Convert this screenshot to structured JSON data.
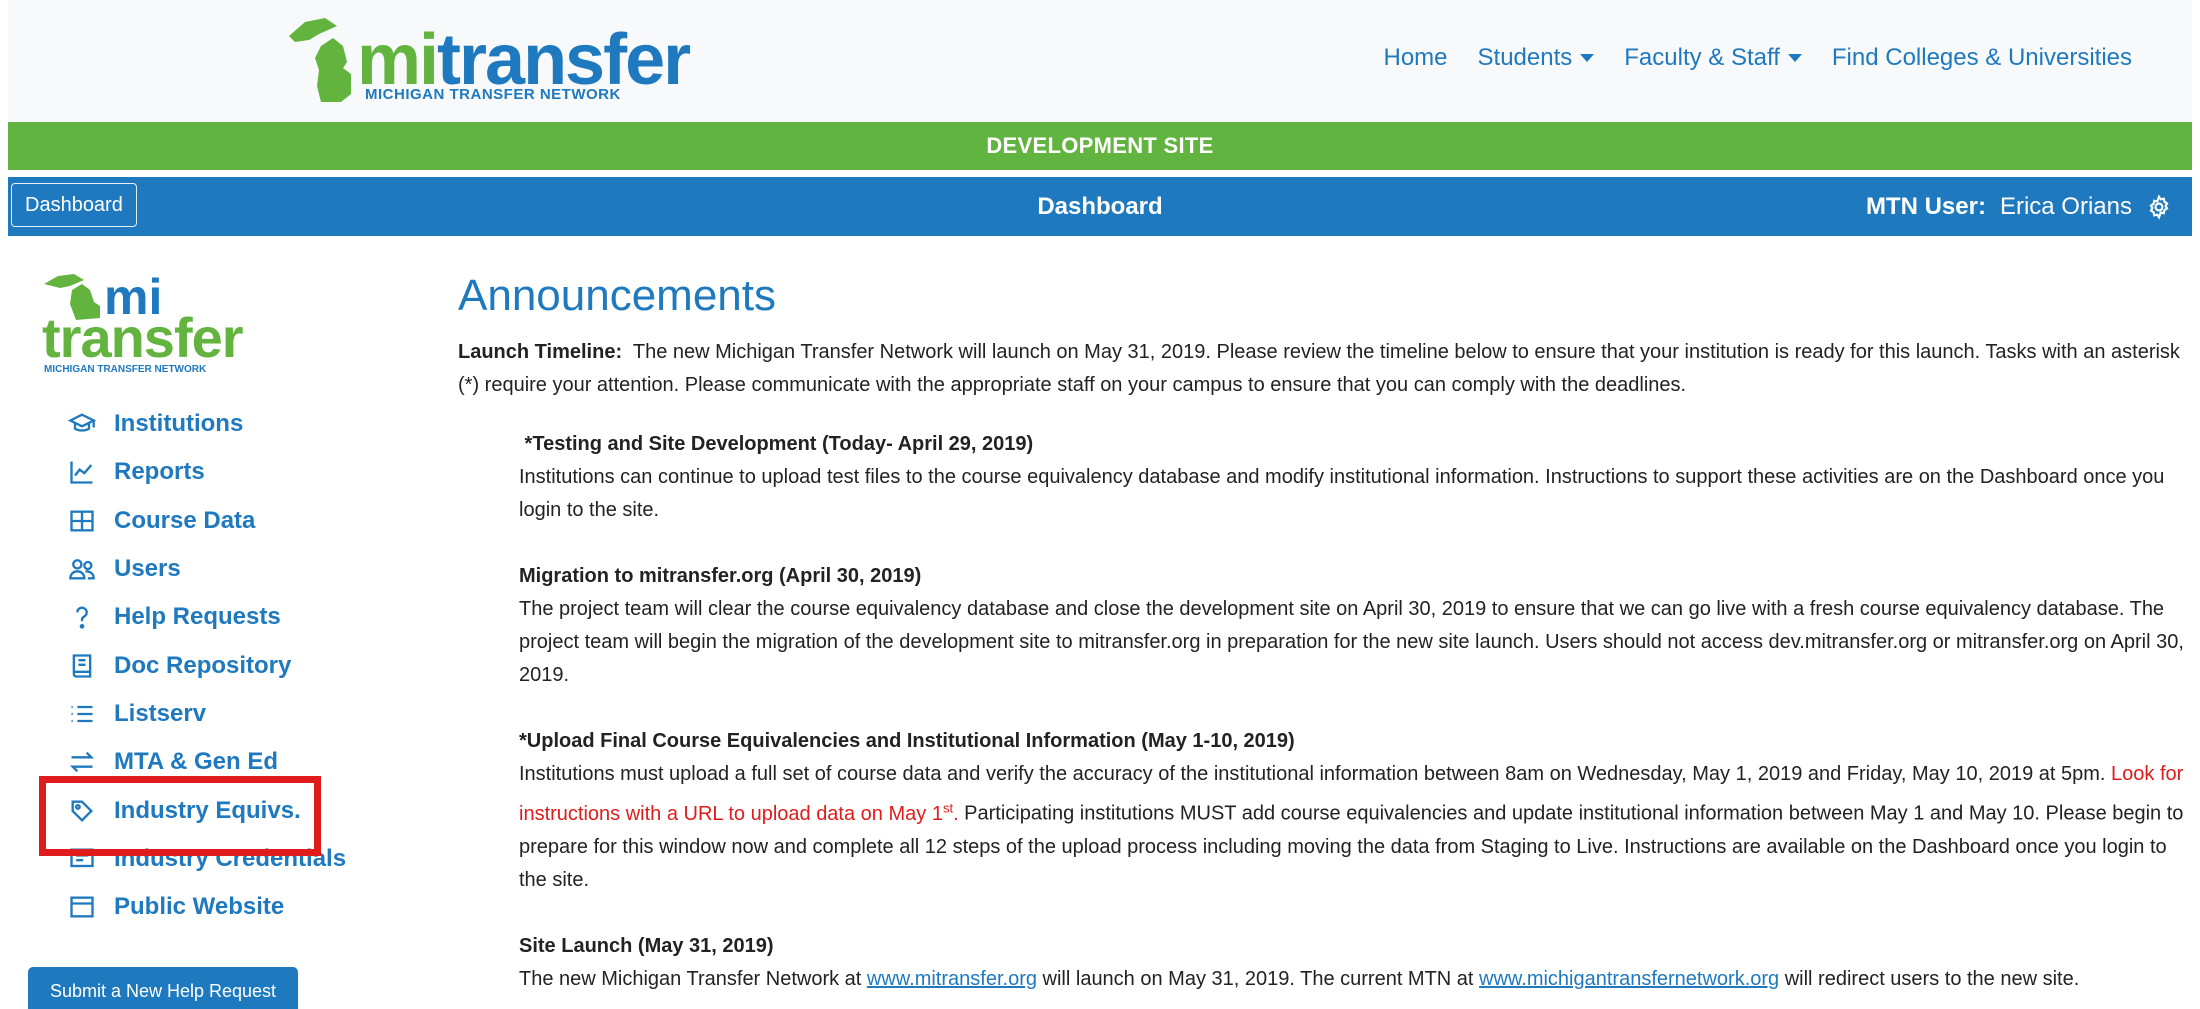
{
  "header": {
    "logo_text_mi": "mi",
    "logo_text_transfer": "transfer",
    "logo_tagline": "MICHIGAN TRANSFER NETWORK",
    "nav": [
      {
        "label": "Home",
        "dropdown": false
      },
      {
        "label": "Students",
        "dropdown": true
      },
      {
        "label": "Faculty & Staff",
        "dropdown": true
      },
      {
        "label": "Find Colleges & Universities",
        "dropdown": false
      }
    ]
  },
  "dev_banner": "DEVELOPMENT SITE",
  "toolbar": {
    "dashboard_button": "Dashboard",
    "title": "Dashboard",
    "user_label": "MTN User:",
    "user_name": "Erica Orians"
  },
  "sidebar": {
    "logo_line1": "mi",
    "logo_line2": "transfer",
    "logo_tagline": "MICHIGAN TRANSFER NETWORK",
    "items": [
      {
        "label": "Institutions",
        "icon": "graduation-cap-icon"
      },
      {
        "label": "Reports",
        "icon": "chart-line-icon"
      },
      {
        "label": "Course Data",
        "icon": "table-icon"
      },
      {
        "label": "Users",
        "icon": "users-icon"
      },
      {
        "label": "Help Requests",
        "icon": "question-icon"
      },
      {
        "label": "Doc Repository",
        "icon": "book-icon"
      },
      {
        "label": "Listserv",
        "icon": "list-icon"
      },
      {
        "label": "MTA & Gen Ed",
        "icon": "arrows-icon"
      },
      {
        "label": "Industry Equivs.",
        "icon": "tag-icon"
      },
      {
        "label": "Industry Credentials",
        "icon": "certificate-icon"
      },
      {
        "label": "Public Website",
        "icon": "browser-icon"
      }
    ],
    "help_button": "Submit a New Help Request"
  },
  "announcements": {
    "title": "Announcements",
    "intro_label": "Launch Timeline:",
    "intro_text": "The new Michigan Transfer Network will launch on May 31, 2019.  Please review the timeline below to ensure that your institution is ready for this launch.  Tasks with an asterisk (*) require your attention.  Please communicate with the appropriate staff on your campus to ensure that you can comply with the deadlines.",
    "s1_title": " *Testing and Site Development (Today- April 29, 2019)",
    "s1_text": "Institutions can continue to upload test files to the course equivalency database and modify institutional information.  Instructions to support these activities are on the Dashboard once you login to the site.",
    "s2_title": "Migration to mitransfer.org (April 30, 2019)",
    "s2_text": "The project team will clear the course equivalency database and close the development site on April 30, 2019 to ensure that we can go live with a fresh course equivalency database.  The project team will begin the migration of the development site to mitransfer.org in preparation for the new site launch.  Users should not access dev.mitransfer.org or mitransfer.org on April 30, 2019.",
    "s3_title": "*Upload Final Course Equivalencies and Institutional Information (May 1-10, 2019)",
    "s3_text_a": "Institutions must upload a full set of course data and verify the accuracy of the institutional information between 8am on Wednesday, May 1, 2019 and Friday, May 10, 2019 at 5pm.  ",
    "s3_text_red": "Look for instructions with a URL to upload data on May 1",
    "s3_text_sup": "st",
    "s3_text_red_end": ".",
    "s3_text_b": "  Participating institutions MUST add course equivalencies and update institutional information between May 1 and May 10.  Please begin to prepare for this window now and complete all 12 steps of the upload process including moving the data from Staging to Live.  Instructions are available on the Dashboard once you login to the site.",
    "s4_title": "Site Launch (May 31, 2019)",
    "s4_text_a": "The new Michigan Transfer Network at ",
    "s4_link1": "www.mitransfer.org",
    "s4_text_b": " will launch on May 31, 2019.  The current MTN at ",
    "s4_link2": "www.michigantransfernetwork.org",
    "s4_text_c": " will redirect users to the new site."
  },
  "colors": {
    "brand_blue": "#1f79be",
    "brand_green": "#62b440",
    "highlight_red": "#e01b1b"
  }
}
